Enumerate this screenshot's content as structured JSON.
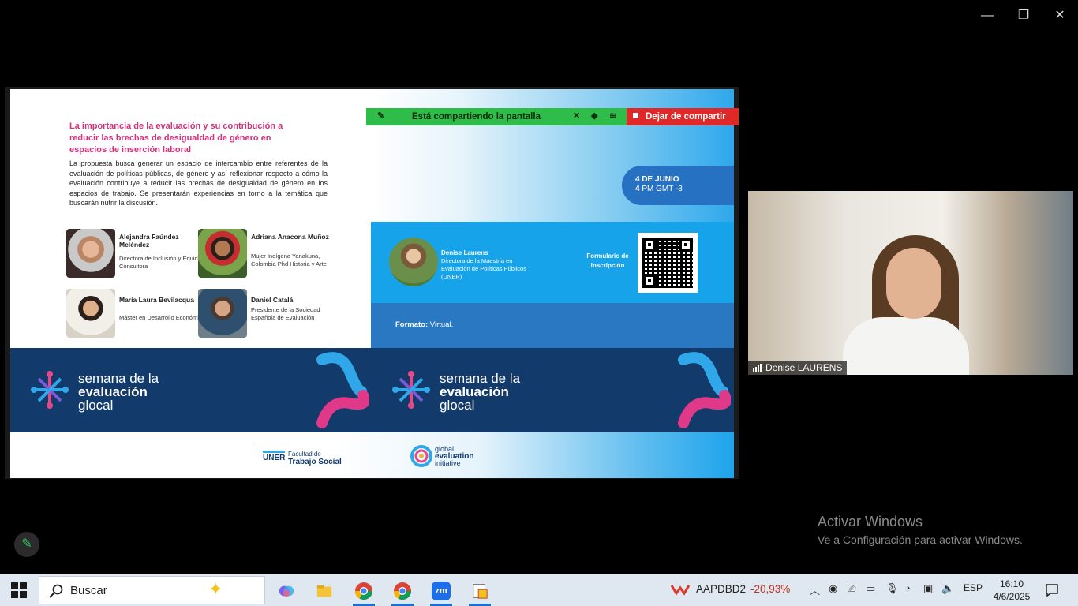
{
  "window_controls": {
    "minimize": "—",
    "restore": "❐",
    "close": "✕"
  },
  "slide": {
    "title": "La importancia de la evaluación y su contribución a reducir las brechas de desigualdad de género en espacios de inserción laboral",
    "description": "La propuesta busca generar un espacio de intercambio entre referentes de la evaluación de políticas públicas, de género y así reflexionar respecto a cómo la evaluación contribuye a reducir las brechas de desigualdad de género en los espacios de trabajo. Se presentarán experiencias en torno a la temática que buscarán nutrir la discusión.",
    "panelists": [
      {
        "name": "Alejandra Faúndez Meléndez",
        "role": "Directora de Inclusión y Equidad Consultora"
      },
      {
        "name": "Adriana Anacona Muñoz",
        "role": "Mujer Indígena Yanakuna, Colombia Phd Historia y Arte"
      },
      {
        "name": "María Laura Bevilacqua",
        "role": "Máster en Desarrollo Económico"
      },
      {
        "name": "Daniel Catalá",
        "role": "Presidente de la Sociedad Española de Evaluación"
      }
    ],
    "date_line1": "4 DE JUNIO",
    "date_line2_bold": "4",
    "date_line2": " PM GMT -3",
    "moderator_name": "Denise Laurens",
    "moderator_role": "Directora de la Maestría en Evaluación de Políticas Públicos (UNER)",
    "form_label": "Formulario de inscripción",
    "formato_label": "Formato:",
    "formato_value": " Virtual.",
    "brand_line1": "semana de la",
    "brand_line2": "evaluación",
    "brand_line3": "glocal",
    "uner_abbr": "UNER",
    "uner_line1": "Facultad de",
    "uner_line2": "Trabajo Social",
    "gei_line1": "global",
    "gei_line2": "evaluation",
    "gei_line3": "initiative"
  },
  "share_bar": {
    "sharing_text": "Está compartiendo la pantalla",
    "stop_label": "Dejar de compartir"
  },
  "video": {
    "participant_name": "Denise LAURENS"
  },
  "watermark": {
    "line1": "Activar Windows",
    "line2": "Ve a Configuración para activar Windows."
  },
  "taskbar": {
    "search_placeholder": "Buscar",
    "zoom_label": "zm",
    "stock_symbol": "AAPDBD2",
    "stock_change": "-20,93%",
    "language": "ESP",
    "time": "16:10",
    "date": "4/6/2025"
  },
  "colors": {
    "accent_pink": "#d6327b",
    "navy": "#123a6b",
    "sky": "#16a3ea",
    "share_green": "#2fbd4a",
    "stop_red": "#e02828"
  }
}
